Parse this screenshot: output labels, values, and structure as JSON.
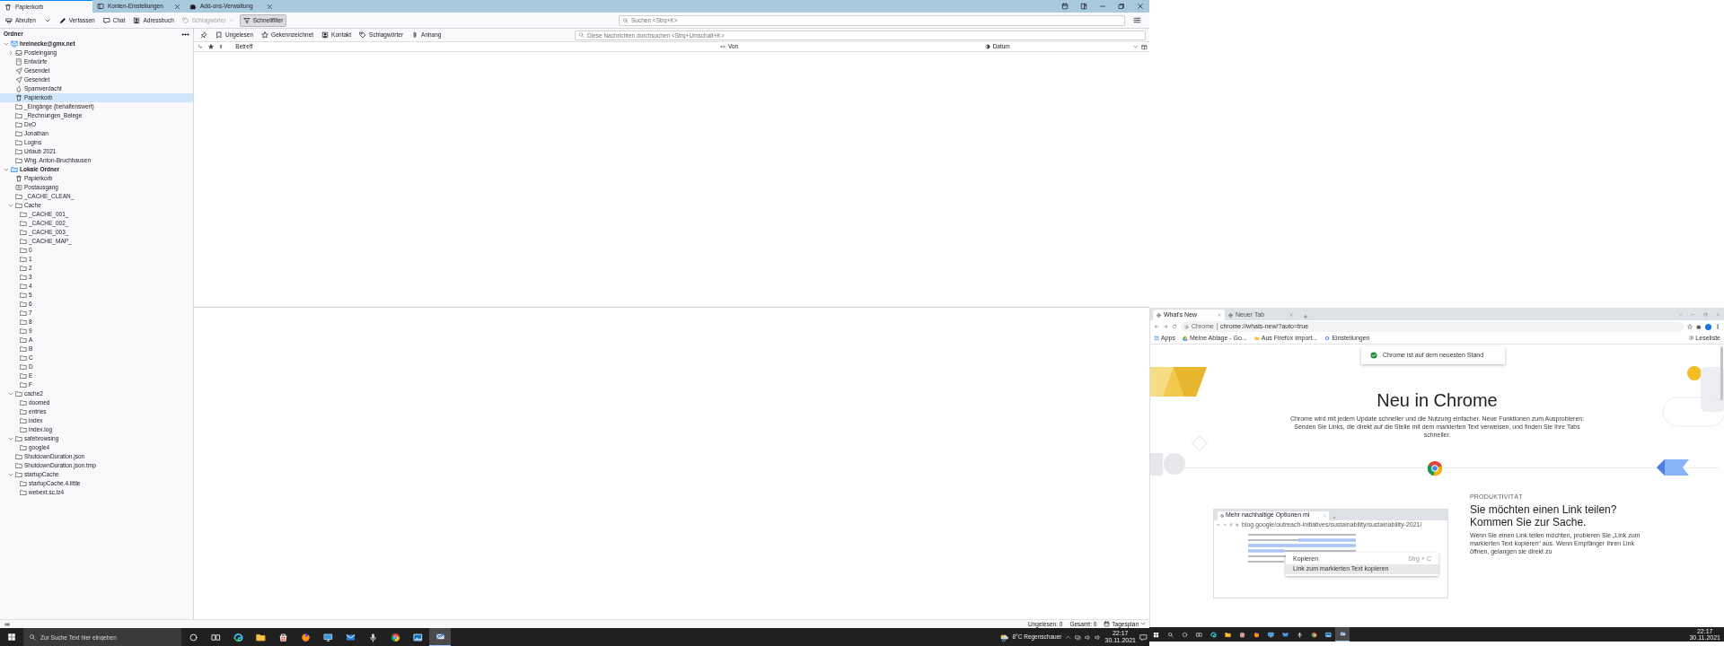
{
  "mail_window": {
    "tabs": [
      {
        "label": "Papierkorb",
        "selected": true,
        "closable": false
      },
      {
        "label": "Konten-Einstellungen",
        "selected": false,
        "closable": true
      },
      {
        "label": "Add-ons-Verwaltung",
        "selected": false,
        "closable": true
      }
    ],
    "toolbar": [
      {
        "kind": "button",
        "label": "Abrufen",
        "disabled": false
      },
      {
        "kind": "caret",
        "disabled": false
      },
      {
        "kind": "button",
        "label": "Verfassen",
        "disabled": false
      },
      {
        "kind": "button",
        "label": "Chat",
        "disabled": false
      },
      {
        "kind": "button",
        "label": "Adressbuch",
        "disabled": false
      },
      {
        "kind": "dropdown",
        "label": "Schlagwörter",
        "disabled": true
      },
      {
        "kind": "toggle",
        "label": "Schnellfilter",
        "disabled": false,
        "pressed": true
      }
    ],
    "search": {
      "placeholder": "Suchen <Strg+K>"
    },
    "folder_pane": {
      "title": "Ordner",
      "folders": [
        {
          "label": "hreinecke@gmx.net",
          "kind": "account",
          "selected": false,
          "expanded": true,
          "children": [
            {
              "label": "Posteingang",
              "kind": "inbox",
              "selected": false,
              "expanded": false
            },
            {
              "label": "Entwürfe",
              "kind": "drafts",
              "selected": false
            },
            {
              "label": "Gesendet",
              "kind": "sent",
              "selected": false
            },
            {
              "label": "Gesendet",
              "kind": "sent",
              "selected": false
            },
            {
              "label": "Spamverdacht",
              "kind": "spam",
              "selected": false
            },
            {
              "label": "Papierkorb",
              "kind": "trash",
              "selected": true
            },
            {
              "label": "_Eingänge (behaltenswert)",
              "kind": "folder",
              "selected": false
            },
            {
              "label": "_Rechnungen_Belege",
              "kind": "folder",
              "selected": false
            },
            {
              "label": "DxO",
              "kind": "folder",
              "selected": false
            },
            {
              "label": "Jonathan",
              "kind": "folder",
              "selected": false
            },
            {
              "label": "Logins",
              "kind": "folder",
              "selected": false
            },
            {
              "label": "Urlaub 2021",
              "kind": "folder",
              "selected": false
            },
            {
              "label": "Whg. Anton-Bruchhausen",
              "kind": "folder",
              "selected": false
            }
          ]
        },
        {
          "label": "Lokale Ordner",
          "kind": "local",
          "selected": false,
          "expanded": true,
          "children": [
            {
              "label": "Papierkorb",
              "kind": "trash",
              "selected": false
            },
            {
              "label": "Postausgang",
              "kind": "outbox",
              "selected": false
            },
            {
              "label": "_CACHE_CLEAN_",
              "kind": "folder",
              "selected": false
            },
            {
              "label": "Cache",
              "kind": "folder",
              "selected": false,
              "expanded": true,
              "children": [
                {
                  "label": "_CACHE_001_",
                  "kind": "folder",
                  "selected": false
                },
                {
                  "label": "_CACHE_002_",
                  "kind": "folder",
                  "selected": false
                },
                {
                  "label": "_CACHE_003_",
                  "kind": "folder",
                  "selected": false
                },
                {
                  "label": "_CACHE_MAP_",
                  "kind": "folder",
                  "selected": false
                },
                {
                  "label": "0",
                  "kind": "folder",
                  "selected": false
                },
                {
                  "label": "1",
                  "kind": "folder",
                  "selected": false
                },
                {
                  "label": "2",
                  "kind": "folder",
                  "selected": false
                },
                {
                  "label": "3",
                  "kind": "folder",
                  "selected": false
                },
                {
                  "label": "4",
                  "kind": "folder",
                  "selected": false
                },
                {
                  "label": "5",
                  "kind": "folder",
                  "selected": false
                },
                {
                  "label": "6",
                  "kind": "folder",
                  "selected": false
                },
                {
                  "label": "7",
                  "kind": "folder",
                  "selected": false
                },
                {
                  "label": "8",
                  "kind": "folder",
                  "selected": false
                },
                {
                  "label": "9",
                  "kind": "folder",
                  "selected": false
                },
                {
                  "label": "A",
                  "kind": "folder",
                  "selected": false
                },
                {
                  "label": "B",
                  "kind": "folder",
                  "selected": false
                },
                {
                  "label": "C",
                  "kind": "folder",
                  "selected": false
                },
                {
                  "label": "D",
                  "kind": "folder",
                  "selected": false
                },
                {
                  "label": "E",
                  "kind": "folder",
                  "selected": false
                },
                {
                  "label": "F",
                  "kind": "folder",
                  "selected": false
                }
              ]
            },
            {
              "label": "cache2",
              "kind": "folder",
              "selected": false,
              "expanded": true,
              "children": [
                {
                  "label": "doomed",
                  "kind": "folder",
                  "selected": false
                },
                {
                  "label": "entries",
                  "kind": "folder",
                  "selected": false
                },
                {
                  "label": "index",
                  "kind": "folder",
                  "selected": false
                },
                {
                  "label": "index.log",
                  "kind": "folder",
                  "selected": false
                }
              ]
            },
            {
              "label": "safebrowsing",
              "kind": "folder",
              "selected": false,
              "expanded": true,
              "children": [
                {
                  "label": "google4",
                  "kind": "folder",
                  "selected": false
                }
              ]
            },
            {
              "label": "ShutdownDuration.json",
              "kind": "folder",
              "selected": false
            },
            {
              "label": "ShutdownDuration.json.tmp",
              "kind": "folder",
              "selected": false
            },
            {
              "label": "startupCache",
              "kind": "folder",
              "selected": false,
              "expanded": true,
              "children": [
                {
                  "label": "startupCache.4.little",
                  "kind": "folder",
                  "selected": false
                },
                {
                  "label": "webext.sc.lz4",
                  "kind": "folder",
                  "selected": false
                }
              ]
            }
          ]
        }
      ]
    },
    "quick_filter": {
      "buttons": [
        {
          "kind": "icon",
          "pressed": false
        },
        {
          "kind": "text",
          "label": "Ungelesen",
          "pressed": false
        },
        {
          "kind": "text",
          "label": "Gekennzeichnet",
          "pressed": false
        },
        {
          "kind": "text",
          "label": "Kontakt",
          "pressed": false
        },
        {
          "kind": "text",
          "label": "Schlagwörter",
          "pressed": false
        },
        {
          "kind": "text",
          "label": "Anhang",
          "pressed": false
        }
      ],
      "search": {
        "placeholder": "Diese Nachrichten durchsuchen <Strg+Umschalt+K>"
      }
    },
    "columns": [
      {
        "kind": "icon"
      },
      {
        "kind": "icon"
      },
      {
        "kind": "icon"
      },
      {
        "kind": "text",
        "label": "Betreff"
      },
      {
        "kind": "text",
        "label": "Von"
      },
      {
        "kind": "text",
        "label": "Datum"
      },
      {
        "kind": "picker"
      }
    ],
    "status_bar": {
      "unread": "Ungelesen: 0",
      "total": "Gesamt: 0",
      "today_pane": "Tagesplan"
    }
  },
  "taskbar": {
    "search_placeholder": "Zur Suche Text hier eingeben",
    "apps": [
      {
        "active": false
      },
      {
        "active": false
      },
      {
        "active": false
      },
      {
        "active": false
      },
      {
        "active": false
      },
      {
        "active": false
      },
      {
        "active": false
      },
      {
        "active": false
      },
      {
        "active": false
      },
      {
        "active": false
      },
      {
        "active": false
      },
      {
        "active": true
      }
    ],
    "weather": "8°C  Regenschauer",
    "time": "22:17",
    "date": "30.11.2021"
  },
  "browser_window": {
    "tabs": [
      {
        "label": "What's New",
        "selected": true
      },
      {
        "label": "Neuer Tab",
        "selected": false
      }
    ],
    "address": {
      "origin": "Chrome",
      "url": "chrome://whats-new/?auto=true"
    },
    "bookmarks": [
      {
        "label": "Apps"
      },
      {
        "label": "Meine Ablage - Go..."
      },
      {
        "label": "Aus Firefox import..."
      },
      {
        "label": "Einstellungen"
      }
    ],
    "reading_list": "Leseliste",
    "toast": "Chrome ist auf dem neuesten Stand",
    "heading": "Neu in Chrome",
    "intro": "Chrome wird mit jedem Update schneller und die Nutzung einfacher. Neue Funktionen zum Ausprobieren: Senden Sie Links, die direkt auf die Stelle mit dem markierten Text verweisen, und finden Sie Ihre Tabs schneller.",
    "section": {
      "eyebrow": "PRODUKTIVITÄT",
      "title": "Sie möchten einen Link teilen? Kommen Sie zur Sache.",
      "body": "Wenn Sie einen Link teilen möchten, probieren Sie „Link zum markierten Text kopieren“ aus. Wenn Empfänger Ihren Link öffnen, gelangen sie direkt zu"
    },
    "demo": {
      "tab": "Mehr nachhaltige Optionen mi",
      "url": "blog.google/outreach-initiatives/sustainability/sustainability-2021/",
      "menu": [
        {
          "label": "Kopieren",
          "shortcut": "Strg + C",
          "selected": false
        },
        {
          "label": "Link zum markierten Text kopieren",
          "selected": true
        }
      ]
    }
  },
  "browser_taskbar": {
    "apps": [
      {
        "active": false
      },
      {
        "active": false
      },
      {
        "active": false
      },
      {
        "active": false
      },
      {
        "active": false
      },
      {
        "active": false
      },
      {
        "active": false
      },
      {
        "active": false
      },
      {
        "active": false
      },
      {
        "active": false
      },
      {
        "active": false
      },
      {
        "active": true
      }
    ],
    "time": "22:17",
    "date": "30.11.2021"
  }
}
